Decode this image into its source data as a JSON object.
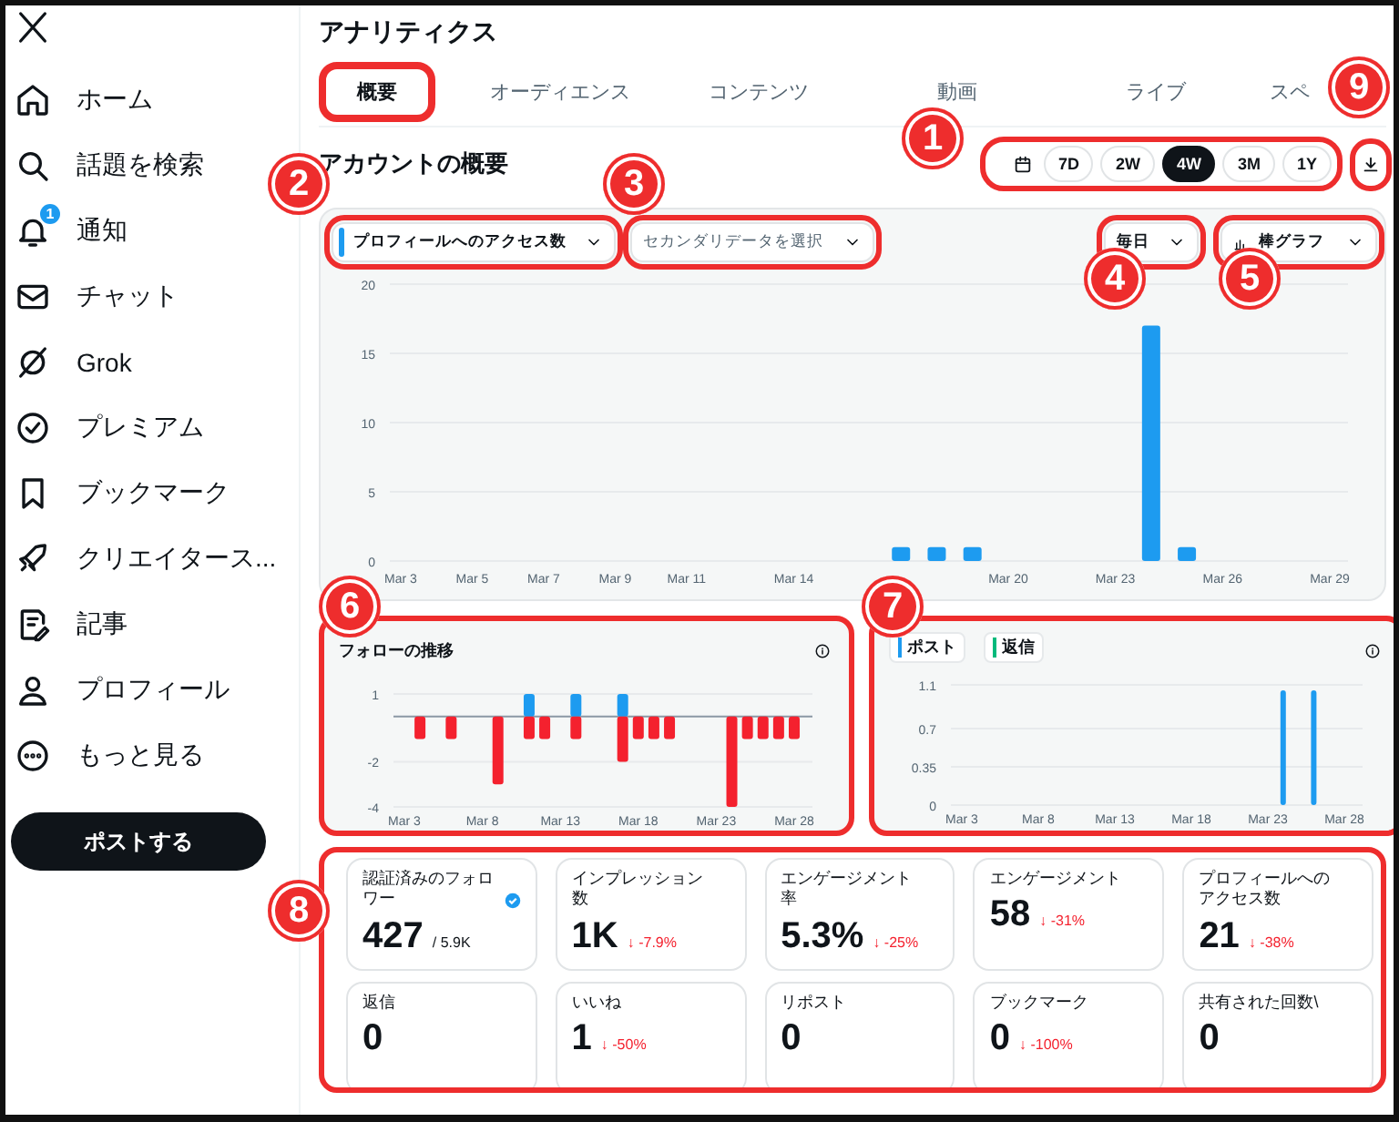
{
  "sidebar": {
    "items": [
      {
        "label": "ホーム"
      },
      {
        "label": "話題を検索"
      },
      {
        "label": "通知",
        "badge": "1"
      },
      {
        "label": "チャット"
      },
      {
        "label": "Grok"
      },
      {
        "label": "プレミアム"
      },
      {
        "label": "ブックマーク"
      },
      {
        "label": "クリエイタース..."
      },
      {
        "label": "記事"
      },
      {
        "label": "プロフィール"
      },
      {
        "label": "もっと見る"
      }
    ],
    "post_button": "ポストする"
  },
  "page_title": "アナリティクス",
  "tabs": [
    {
      "label": "概要",
      "selected": true
    },
    {
      "label": "オーディエンス",
      "selected": false
    },
    {
      "label": "コンテンツ",
      "selected": false
    },
    {
      "label": "動画",
      "selected": false
    },
    {
      "label": "ライブ",
      "selected": false
    },
    {
      "label": "スペ",
      "selected": false
    }
  ],
  "overview": {
    "title": "アカウントの概要",
    "ranges": [
      {
        "label": "7D",
        "selected": false
      },
      {
        "label": "2W",
        "selected": false
      },
      {
        "label": "4W",
        "selected": true
      },
      {
        "label": "3M",
        "selected": false
      },
      {
        "label": "1Y",
        "selected": false
      }
    ],
    "controls": [
      {
        "kind": "metric",
        "label": "プロフィールへのアクセス数",
        "color": "#1d9bf0"
      },
      {
        "kind": "secondary",
        "label": "セカンダリデータを選択"
      },
      {
        "kind": "interval",
        "label": "毎日"
      },
      {
        "kind": "chart_type",
        "label": "棒グラフ"
      }
    ],
    "chart_data": {
      "type": "bar",
      "categories": [
        "Mar 3",
        null,
        "Mar 5",
        null,
        "Mar 7",
        null,
        "Mar 9",
        null,
        "Mar 11",
        null,
        null,
        "Mar 14",
        null,
        null,
        null,
        null,
        null,
        "Mar 20",
        null,
        null,
        "Mar 23",
        null,
        null,
        "Mar 26",
        null,
        null,
        "Mar 29"
      ],
      "series": [
        {
          "color": "#1d9bf0",
          "values": [
            0,
            0,
            0,
            0,
            0,
            0,
            0,
            0,
            0,
            0,
            0,
            0,
            0,
            0,
            1,
            1,
            1,
            0,
            0,
            0,
            0,
            17,
            1,
            0,
            0,
            0,
            0
          ]
        }
      ],
      "ylim": [
        0,
        20
      ],
      "yticks": [
        0,
        5,
        10,
        15,
        20
      ],
      "grid": true
    }
  },
  "follower_trend": {
    "title": "フォローの推移",
    "chart_data": {
      "type": "bar",
      "categories": [
        "Mar 3",
        null,
        null,
        null,
        null,
        "Mar 8",
        null,
        null,
        null,
        null,
        "Mar 13",
        null,
        null,
        null,
        null,
        "Mar 18",
        null,
        null,
        null,
        null,
        "Mar 23",
        null,
        null,
        null,
        null,
        "Mar 28"
      ],
      "series": [
        {
          "color": "#1d9bf0",
          "values": [
            0,
            0,
            0,
            0,
            0,
            0,
            0,
            0,
            1,
            0,
            0,
            1,
            0,
            0,
            1,
            0,
            0,
            0,
            0,
            0,
            0,
            0,
            0,
            0,
            0,
            0
          ]
        },
        {
          "color": "#f4212e",
          "values": [
            0,
            -1,
            0,
            -1,
            0,
            0,
            -3,
            0,
            -1,
            -1,
            0,
            -1,
            0,
            0,
            -2,
            -1,
            -1,
            -1,
            0,
            0,
            0,
            -4,
            -1,
            -1,
            -1,
            -1
          ]
        }
      ],
      "ylim": [
        -4,
        1
      ],
      "yticks": [
        1,
        -2,
        -4
      ],
      "grid": true
    }
  },
  "posts_replies": {
    "chart_data": {
      "type": "bar",
      "categories": [
        "Mar 3",
        null,
        null,
        null,
        null,
        "Mar 8",
        null,
        null,
        null,
        null,
        "Mar 13",
        null,
        null,
        null,
        null,
        "Mar 18",
        null,
        null,
        null,
        null,
        "Mar 23",
        null,
        null,
        null,
        null,
        "Mar 28"
      ],
      "series": [
        {
          "name": "ポスト",
          "color": "#1d9bf0",
          "values": [
            0,
            0,
            0,
            0,
            0,
            0,
            0,
            0,
            0,
            0,
            0,
            0,
            0,
            0,
            0,
            0,
            0,
            0,
            0,
            0,
            0,
            1.05,
            0,
            1.05,
            0,
            0
          ]
        },
        {
          "name": "返信",
          "color": "#00ba7c",
          "values": [
            0,
            0,
            0,
            0,
            0,
            0,
            0,
            0,
            0,
            0,
            0,
            0,
            0,
            0,
            0,
            0,
            0,
            0,
            0,
            0,
            0,
            0,
            0,
            0,
            0,
            0
          ]
        }
      ],
      "ylim": [
        0,
        1.1
      ],
      "yticks": [
        {
          "value": 1.1,
          "label": "1.1"
        },
        {
          "value": 0.7,
          "label": "0.7"
        },
        {
          "value": 0.35,
          "label": "0.35"
        },
        0
      ],
      "grid": true
    }
  },
  "stats": [
    {
      "label": "認証済みのフォロワー",
      "value": "427",
      "sub": "/ 5.9K",
      "verified": true
    },
    {
      "label": "インプレッション数",
      "value": "1K",
      "change": "↓ -7.9%"
    },
    {
      "label": "エンゲージメント率",
      "value": "5.3%",
      "change": "↓ -25%"
    },
    {
      "label": "エンゲージメント",
      "value": "58",
      "change": "↓ -31%"
    },
    {
      "label": "プロフィールへのアクセス数",
      "value": "21",
      "change": "↓ -38%"
    },
    {
      "label": "返信",
      "value": "0"
    },
    {
      "label": "いいね",
      "value": "1",
      "change": "↓ -50%"
    },
    {
      "label": "リポスト",
      "value": "0"
    },
    {
      "label": "ブックマーク",
      "value": "0",
      "change": "↓ -100%"
    },
    {
      "label": "共有された回数\\",
      "value": "0"
    }
  ],
  "callouts": [
    "1",
    "2",
    "3",
    "4",
    "5",
    "6",
    "7",
    "8",
    "9"
  ]
}
